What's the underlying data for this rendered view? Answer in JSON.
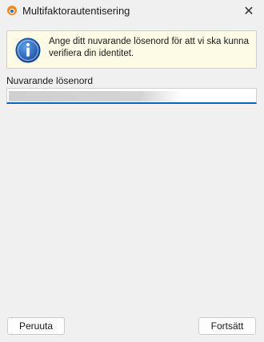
{
  "window": {
    "title": "Multifaktorautentisering",
    "close_glyph": "✕",
    "app_icon": "app-logo-icon"
  },
  "info": {
    "icon": "info-icon",
    "message": "Ange ditt nuvarande lösenord för att vi ska kunna verifiera din identitet."
  },
  "password": {
    "label": "Nuvarande lösenord",
    "value": ""
  },
  "buttons": {
    "cancel_label": "Peruuta",
    "continue_label": "Fortsätt"
  },
  "colors": {
    "accent": "#0067c0",
    "info_background": "#fdfbe6",
    "info_icon": "#1f5fb8",
    "app_icon_orange": "#f28c1e",
    "app_icon_blue": "#1e73be"
  }
}
